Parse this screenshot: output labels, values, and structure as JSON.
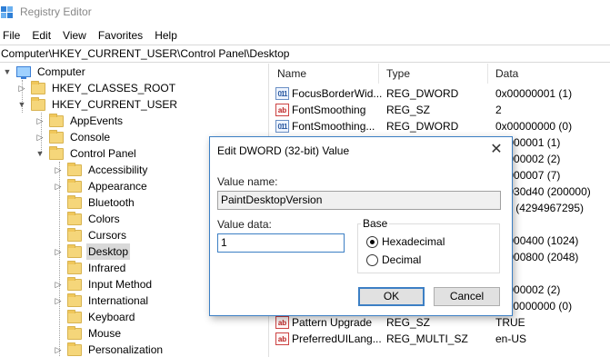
{
  "window": {
    "title": "Registry Editor"
  },
  "menu": [
    "File",
    "Edit",
    "View",
    "Favorites",
    "Help"
  ],
  "address": "Computer\\HKEY_CURRENT_USER\\Control Panel\\Desktop",
  "tree": {
    "root": "Computer",
    "hkcr": "HKEY_CLASSES_ROOT",
    "hkcu": "HKEY_CURRENT_USER",
    "appevents": "AppEvents",
    "console": "Console",
    "control_panel": "Control Panel",
    "children": [
      "Accessibility",
      "Appearance",
      "Bluetooth",
      "Colors",
      "Cursors",
      "Desktop",
      "Infrared",
      "Input Method",
      "International",
      "Keyboard",
      "Mouse",
      "Personalization"
    ],
    "selected": "Desktop"
  },
  "list": {
    "headers": {
      "name": "Name",
      "type": "Type",
      "data": "Data"
    },
    "rows": [
      {
        "icon": "binary-value-icon",
        "name": "FocusBorderWid...",
        "type": "REG_DWORD",
        "data": "0x00000001 (1)"
      },
      {
        "icon": "string-value-icon",
        "name": "FontSmoothing",
        "type": "REG_SZ",
        "data": "2"
      },
      {
        "icon": "binary-value-icon",
        "name": "FontSmoothing...",
        "type": "REG_DWORD",
        "data": "0x00000000 (0)"
      },
      {
        "icon": "",
        "name": "",
        "type": "",
        "data": "00000001 (1)"
      },
      {
        "icon": "",
        "name": "",
        "type": "",
        "data": "00000002 (2)"
      },
      {
        "icon": "",
        "name": "",
        "type": "",
        "data": "00000007 (7)"
      },
      {
        "icon": "",
        "name": "",
        "type": "",
        "data": "00030d40 (200000)"
      },
      {
        "icon": "",
        "name": "",
        "type": "",
        "data": "ffffff (4294967295)"
      },
      {
        "icon": "",
        "name": "",
        "type": "",
        "data": ""
      },
      {
        "icon": "",
        "name": "",
        "type": "",
        "data": "00000400 (1024)"
      },
      {
        "icon": "",
        "name": "",
        "type": "",
        "data": "00000800 (2048)"
      },
      {
        "icon": "",
        "name": "",
        "type": "",
        "data": ""
      },
      {
        "icon": "",
        "name": "",
        "type": "",
        "data": "00000002 (2)"
      },
      {
        "icon": "binary-value-icon",
        "name": "PaintDesktopVer...",
        "type": "REG_DWORD",
        "data": "0x00000000 (0)"
      },
      {
        "icon": "string-value-icon",
        "name": "Pattern Upgrade",
        "type": "REG_SZ",
        "data": "TRUE"
      },
      {
        "icon": "string-value-icon",
        "name": "PreferredUILang...",
        "type": "REG_MULTI_SZ",
        "data": "en-US"
      }
    ]
  },
  "dialog": {
    "title": "Edit DWORD (32-bit) Value",
    "close_glyph": "✕",
    "value_name_label": "Value name:",
    "value_name": "PaintDesktopVersion",
    "value_data_label": "Value data:",
    "value_data": "1",
    "base_label": "Base",
    "hex_label": "Hexadecimal",
    "dec_label": "Decimal",
    "base_selected": "Hexadecimal",
    "ok_label": "OK",
    "cancel_label": "Cancel"
  },
  "colors": {
    "accent": "#3c7fc4",
    "folder": "#f5d67a",
    "selection": "#d9d9d9"
  }
}
